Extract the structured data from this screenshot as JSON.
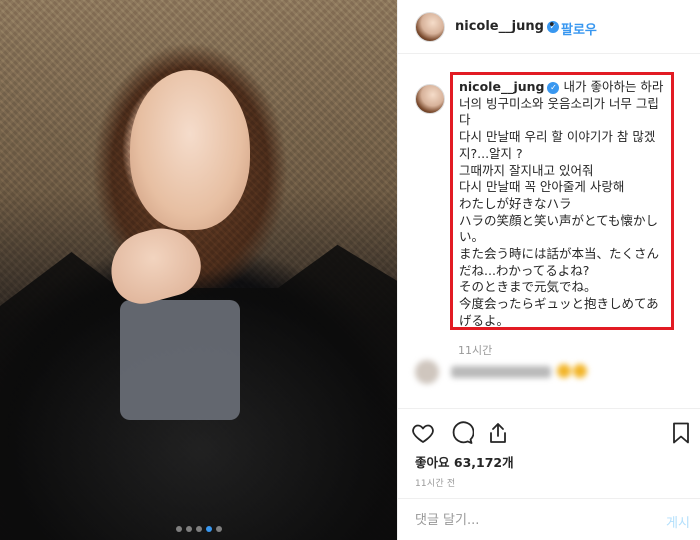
{
  "post": {
    "username": "nicole__jung",
    "follow_label": "팔로우",
    "header_separator": "•"
  },
  "caption": {
    "username": "nicole__jung",
    "text": "내가 좋아하는 하라너의 빙구미소와 웃음소리가 너무 그립다\n다시 만날때 우리 할 이야기가 참 많겠지?...알지 ?\n그때까지 잘지내고 있어줘\n다시 만날때 꼭 안아줄게 사랑해\nわたしが好きなハラ\nハラの笑顔と笑い声がとても懐かしい。\nまた会う時には話が本当、たくさんだね...わかってるよね?\nそのときまで元気でね。\n今度会ったらギュッと抱きしめてあげるよ。"
  },
  "comments": {
    "visible_time": "11시간"
  },
  "actions": {
    "like_icon": "heart-outline-icon",
    "comment_icon": "speech-bubble-icon",
    "share_icon": "share-icon",
    "bookmark_icon": "bookmark-icon"
  },
  "likes": {
    "label": "좋아요",
    "count": "63,172개"
  },
  "timestamp": "11시간 전",
  "comment_box": {
    "placeholder": "댓글 달기...",
    "post_label": "게시"
  },
  "carousel": {
    "dot_count": 5,
    "active_index": 3
  },
  "colors": {
    "accent_blue": "#3897f0",
    "highlight_red": "#e21b23"
  }
}
